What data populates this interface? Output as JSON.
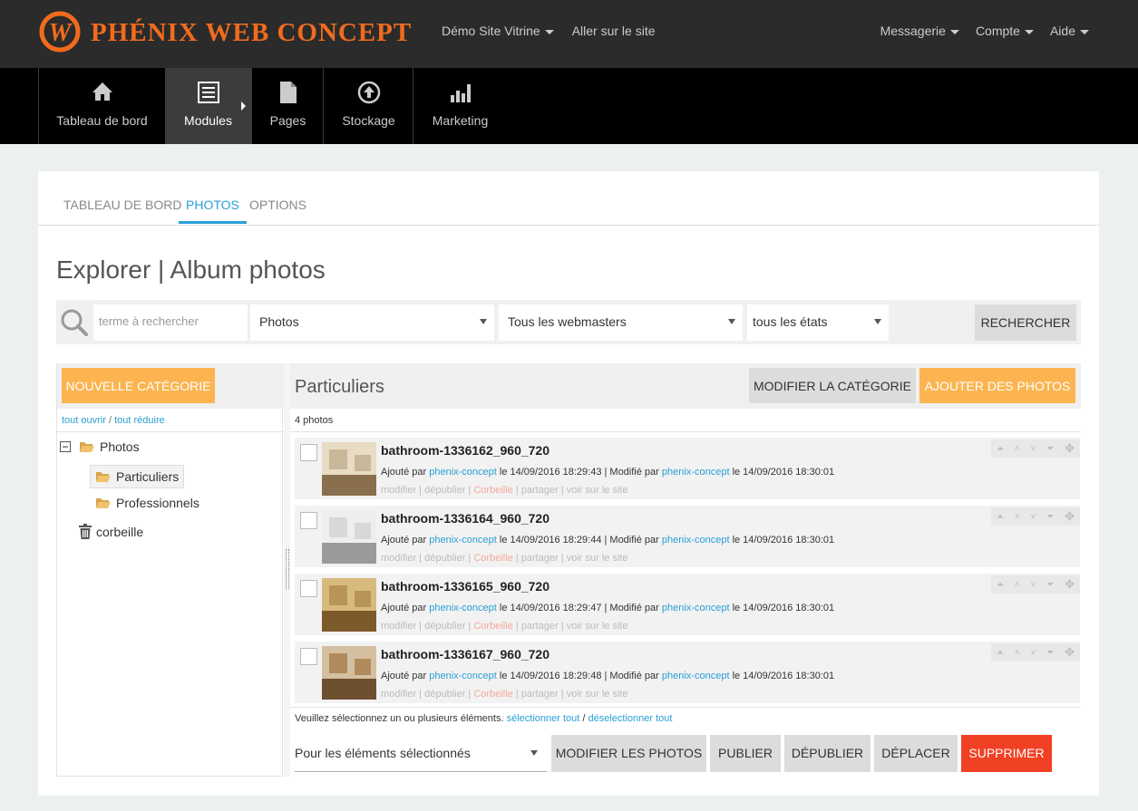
{
  "header": {
    "logo_text": "PHÉNIX WEB CONCEPT",
    "nav_left": [
      "Démo Site Vitrine",
      "Aller sur le site"
    ],
    "nav_right": [
      "Messagerie",
      "Compte",
      "Aide"
    ]
  },
  "modules": [
    {
      "label": "Tableau de bord",
      "icon": "home-icon"
    },
    {
      "label": "Modules",
      "icon": "list-icon"
    },
    {
      "label": "Pages",
      "icon": "page-icon"
    },
    {
      "label": "Stockage",
      "icon": "upload-icon"
    },
    {
      "label": "Marketing",
      "icon": "chart-icon"
    }
  ],
  "tabs": [
    "TABLEAU DE BORD",
    "PHOTOS",
    "OPTIONS"
  ],
  "page_title": "Explorer | Album photos",
  "search": {
    "placeholder": "terme à rechercher",
    "type": "Photos",
    "webmaster": "Tous les webmasters",
    "state": "tous les états",
    "button": "RECHERCHER"
  },
  "tree": {
    "new_button": "NOUVELLE CATÉGORIE",
    "open_all": "tout ouvrir",
    "sep": "/",
    "close_all": "tout réduire",
    "root": "Photos",
    "children": [
      "Particuliers",
      "Professionnels"
    ],
    "trash": "corbeille"
  },
  "content": {
    "title": "Particuliers",
    "edit_button": "MODIFIER LA CATÉGORIE",
    "add_button": "AJOUTER DES PHOTOS",
    "count": "4 photos",
    "items": [
      {
        "name": "bathroom-1336162_960_720",
        "added_prefix": "Ajouté par",
        "added_by": "phenix-concept",
        "added_date": "le 14/09/2016 18:29:43 | Modifié par",
        "modified_by": "phenix-concept",
        "modified_date": "le 14/09/2016 18:30:01"
      },
      {
        "name": "bathroom-1336164_960_720",
        "added_prefix": "Ajouté par",
        "added_by": "phenix-concept",
        "added_date": "le 14/09/2016 18:29:44 | Modifié par",
        "modified_by": "phenix-concept",
        "modified_date": "le 14/09/2016 18:30:01"
      },
      {
        "name": "bathroom-1336165_960_720",
        "added_prefix": "Ajouté par",
        "added_by": "phenix-concept",
        "added_date": "le 14/09/2016 18:29:47 | Modifié par",
        "modified_by": "phenix-concept",
        "modified_date": "le 14/09/2016 18:30:01"
      },
      {
        "name": "bathroom-1336167_960_720",
        "added_prefix": "Ajouté par",
        "added_by": "phenix-concept",
        "added_date": "le 14/09/2016 18:29:48 | Modifié par",
        "modified_by": "phenix-concept",
        "modified_date": "le 14/09/2016 18:30:01"
      }
    ],
    "row_actions": [
      "modifier",
      "dépublier",
      "Corbeille",
      "partager",
      "voir sur le site"
    ],
    "select_hint": "Veuillez sélectionnez un ou plusieurs éléments.",
    "select_all": "sélectionner tout",
    "deselect_all": "déselectionner tout",
    "bulk_select": "Pour les éléments sélectionnés",
    "bulk_buttons": [
      "MODIFIER LES PHOTOS",
      "PUBLIER",
      "DÉPUBLIER",
      "DÉPLACER",
      "SUPPRIMER"
    ]
  },
  "colors": {
    "accent": "#2a9fd6",
    "orange": "#fbb450",
    "red": "#f04124",
    "logo": "#f26b1d"
  }
}
